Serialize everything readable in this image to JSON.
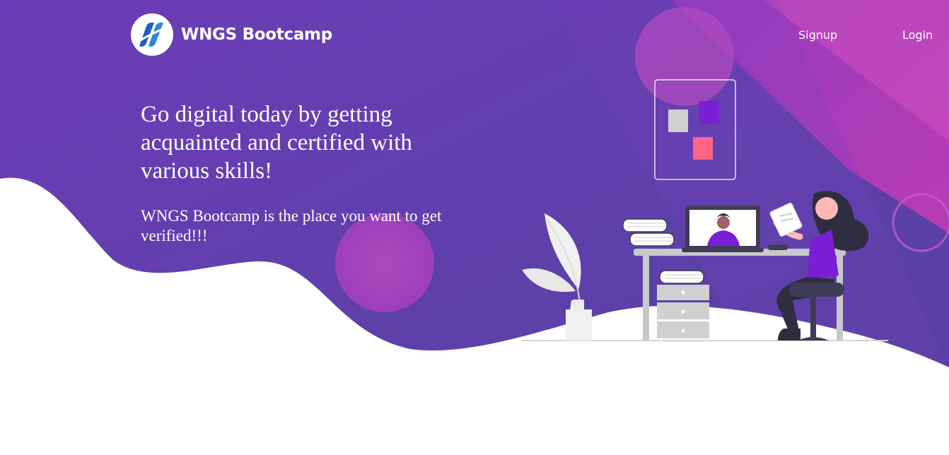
{
  "brand": {
    "name": "WNGS Bootcamp",
    "logo_icon": "wngs-logo-icon"
  },
  "nav": {
    "signup_label": "Signup",
    "login_label": "Login"
  },
  "hero": {
    "headline": "Go digital today by getting acquainted and certified with various skills!",
    "subtext": "WNGS Bootcamp is the place you want to get verified!!!",
    "illustration": "online-learning-illustration"
  },
  "colors": {
    "purple_start": "#6a3fb6",
    "purple_end": "#5a40a6",
    "magenta_accent": "#b63cb8",
    "text_on_purple": "#ffffff",
    "accent_purple": "#7a1fd6",
    "accent_pink": "#ff6584"
  }
}
